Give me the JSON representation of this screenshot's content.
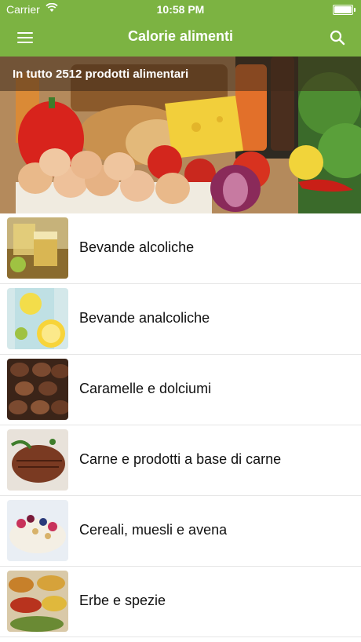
{
  "status_bar": {
    "carrier": "Carrier",
    "time": "10:58 PM"
  },
  "nav": {
    "title": "Calorie alimenti",
    "menu_icon": "hamburger-menu-icon",
    "search_icon": "search-icon"
  },
  "hero": {
    "caption": "In tutto 2512 prodotti alimentari"
  },
  "categories": [
    {
      "label": "Bevande alcoliche"
    },
    {
      "label": "Bevande analcoliche"
    },
    {
      "label": "Caramelle e dolciumi"
    },
    {
      "label": "Carne e prodotti a base di carne"
    },
    {
      "label": "Cereali, muesli e avena"
    },
    {
      "label": "Erbe e spezie"
    }
  ],
  "colors": {
    "accent": "#7cb342"
  }
}
